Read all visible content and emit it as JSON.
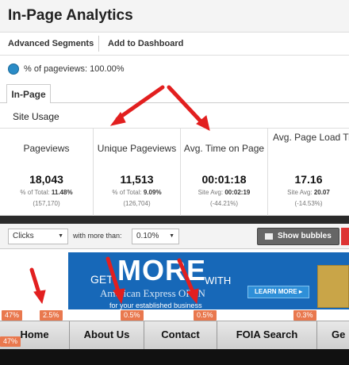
{
  "app_title": "In-Page Analytics",
  "toolbar": {
    "advanced_segments": "Advanced Segments",
    "add_to_dashboard": "Add to Dashboard"
  },
  "segment": {
    "label": "% of pageviews: 100.00%",
    "icon": "pie-chart-icon"
  },
  "tabs": [
    {
      "label": "In-Page"
    }
  ],
  "site_usage": {
    "title": "Site Usage",
    "metrics": [
      {
        "label": "Pageviews",
        "value": "18,043",
        "sub_label": "% of Total:",
        "sub_value": "11.48%",
        "detail": "(157,170)"
      },
      {
        "label": "Unique Pageviews",
        "value": "11,513",
        "sub_label": "% of Total:",
        "sub_value": "9.09%",
        "detail": "(126,704)"
      },
      {
        "label": "Avg. Time on Page",
        "value": "00:01:18",
        "sub_label": "Site Avg:",
        "sub_value": "00:02:19",
        "detail": "(-44.21%)"
      },
      {
        "label": "Avg. Page Load Ti (sec)",
        "value": "17.16",
        "sub_label": "Site Avg:",
        "sub_value": "20.07",
        "detail": "(-14.53%)"
      }
    ]
  },
  "filters": {
    "metric_select": "Clicks",
    "with_more_than": "with more than:",
    "threshold_select": "0.10%",
    "show_bubbles": "Show bubbles"
  },
  "banner": {
    "get": "GET",
    "more": "MORE",
    "with": "WITH",
    "amex": "American Express OPEN",
    "business": "for your established business",
    "learn_more": "LEARN MORE ▸"
  },
  "badges": {
    "b1": "47%",
    "b2": "2.5%",
    "b3": "0.5%",
    "b4": "0.5%",
    "b5": "0.3%",
    "b6": "47%"
  },
  "nav": {
    "items": [
      {
        "label": "Home"
      },
      {
        "label": "About Us"
      },
      {
        "label": "Contact"
      },
      {
        "label": "FOIA Search"
      },
      {
        "label": "Ge"
      }
    ]
  },
  "colors": {
    "badge": "#e9784e",
    "banner": "#1768b8",
    "arrow": "#e21f1f"
  }
}
